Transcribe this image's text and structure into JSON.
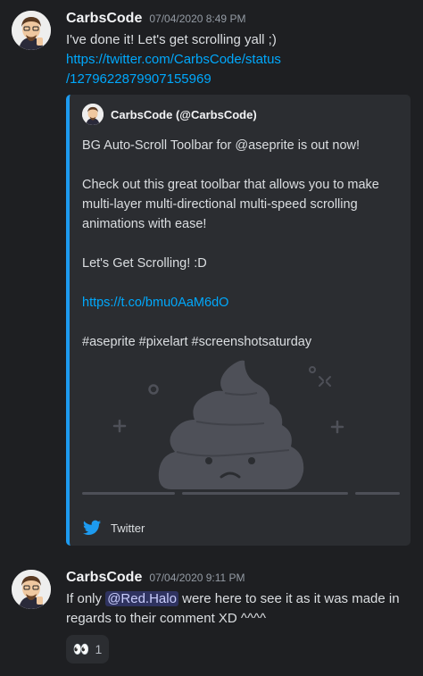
{
  "messages": [
    {
      "username": "CarbsCode",
      "timestamp": "07/04/2020 8:49 PM",
      "text": "I've done it! Let's get scrolling yall ;)",
      "link_line1": "https://twitter.com/CarbsCode/status",
      "link_line2": "/1279622879907155969"
    },
    {
      "username": "CarbsCode",
      "timestamp": "07/04/2020 9:11 PM",
      "text_before": "If only ",
      "mention": "@Red.Halo",
      "text_after": " were here to see it as it was made in regards to their comment XD ^^^^"
    }
  ],
  "embed": {
    "accent_color": "#1d9bf0",
    "author": "CarbsCode (@CarbsCode)",
    "line1": "BG Auto-Scroll Toolbar for @aseprite is out now!",
    "line2": "Check out this great toolbar that allows you to make multi-layer multi-directional multi-speed scrolling animations with ease!",
    "line3": "Let's Get Scrolling! :D",
    "link": "https://t.co/bmu0AaM6dO",
    "hashtags": "#aseprite #pixelart #screenshotsaturday",
    "image": "broken-image-placeholder-icon",
    "footer_icon": "twitter-bird-icon",
    "footer": "Twitter"
  },
  "reaction": {
    "emoji": "👀",
    "count": "1"
  }
}
